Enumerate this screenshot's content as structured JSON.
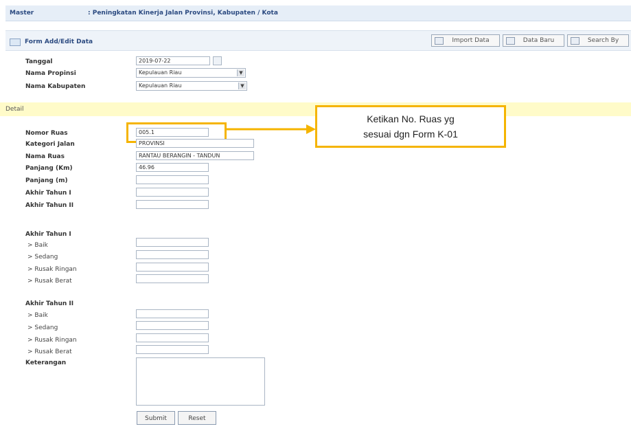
{
  "header": {
    "label": "Master",
    "title": ": Peningkatan Kinerja Jalan Provinsi, Kabupaten / Kota"
  },
  "panel": {
    "label": "Form Add/Edit Data",
    "buttons": {
      "import": "Import Data",
      "new": "Data Baru",
      "search": "Search By"
    }
  },
  "top_form": {
    "tanggal_label": "Tanggal",
    "tanggal_value": "2019-07-22",
    "propinsi_label": "Nama Propinsi",
    "propinsi_value": "Kepulauan Riau",
    "kabupaten_label": "Nama Kabupaten",
    "kabupaten_value": "Kepulauan Riau"
  },
  "detail": {
    "section_label": "Detail",
    "nomor_ruas_label": "Nomor Ruas",
    "nomor_ruas_value": "005.1",
    "kategori_label": "Kategori Jalan",
    "kategori_value": "PROVINSI",
    "nama_ruas_label": "Nama Ruas",
    "nama_ruas_value": "RANTAU BERANGIN - TANDUN",
    "panjang_km_label": "Panjang (Km)",
    "panjang_km_value": "46.96",
    "panjang_m_label": "Panjang (m)",
    "akhir_1_label": "Akhir Tahun I",
    "akhir_2_label": "Akhir Tahun II"
  },
  "kondisi_1": {
    "heading": "Akhir Tahun I",
    "baik": "> Baik",
    "sedang": "> Sedang",
    "rusak_ringan": "> Rusak Ringan",
    "rusak_berat": "> Rusak Berat"
  },
  "kondisi_2": {
    "heading": "Akhir Tahun II",
    "baik": "> Baik",
    "sedang": "> Sedang",
    "rusak_ringan": "> Rusak Ringan",
    "rusak_berat": "> Rusak Berat"
  },
  "keterangan_label": "Keterangan",
  "actions": {
    "submit": "Submit",
    "reset": "Reset"
  },
  "callout": {
    "line1": "Ketikan No. Ruas yg",
    "line2": "sesuai dgn Form K-01"
  },
  "icons": {
    "calendar": "calendar-icon",
    "import": "import-icon",
    "new": "new-data-icon",
    "search": "search-icon",
    "form": "form-icon"
  },
  "colors": {
    "highlight": "#f5b400",
    "detail_bar": "#fffbc9",
    "header_bg": "#e6eef7"
  }
}
